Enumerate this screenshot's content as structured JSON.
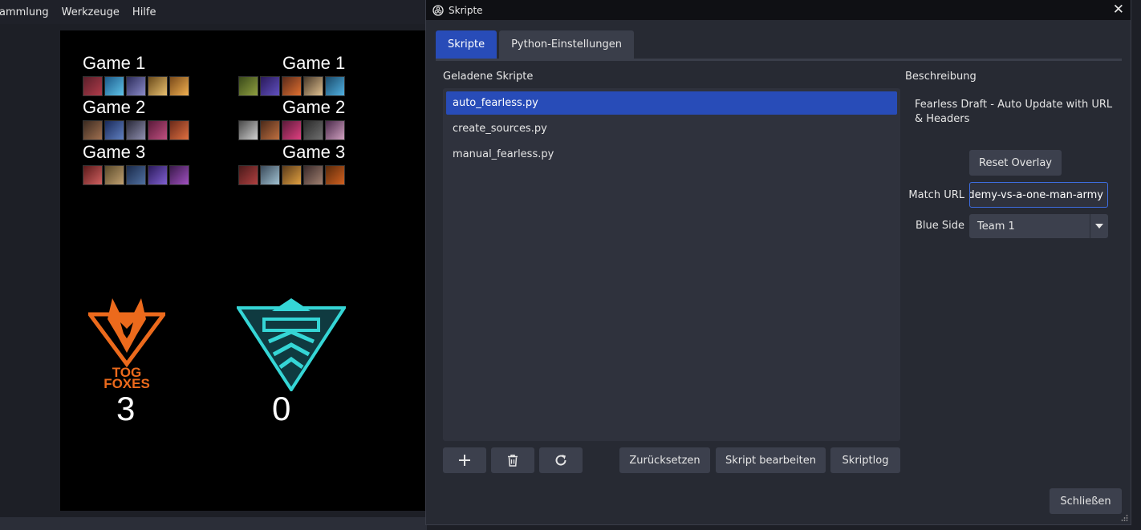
{
  "main_window": {
    "menu": [
      "ammlung",
      "Werkzeuge",
      "Hilfe"
    ]
  },
  "overlay": {
    "left_games": [
      "Game 1",
      "Game 2",
      "Game 3"
    ],
    "right_games": [
      "Game 1",
      "Game 2",
      "Game 3"
    ],
    "left_team_name": "TOG FOXES",
    "left_score": "3",
    "right_score": "0",
    "colors": {
      "fox_orange": "#ec6a1c",
      "right_team_teal": "#35d6d6"
    }
  },
  "dialog": {
    "title": "Skripte",
    "close_icon": "close-icon",
    "tabs": [
      {
        "label": "Skripte",
        "active": true
      },
      {
        "label": "Python-Einstellungen",
        "active": false
      }
    ],
    "loaded_scripts_label": "Geladene Skripte",
    "scripts": [
      {
        "name": "auto_fearless.py",
        "selected": true
      },
      {
        "name": "create_sources.py",
        "selected": false
      },
      {
        "name": "manual_fearless.py",
        "selected": false
      }
    ],
    "icon_buttons": [
      "add-icon",
      "trash-icon",
      "reload-icon"
    ],
    "buttons": {
      "reset": "Zurücksetzen",
      "edit": "Skript bearbeiten",
      "log": "Skriptlog",
      "close": "Schließen"
    },
    "description_label": "Beschreibung",
    "description": "Fearless Draft - Auto Update with URL & Headers",
    "properties": {
      "reset_overlay_label": "Reset Overlay",
      "match_url_label": "Match URL",
      "match_url_value": "ademy-vs-a-one-man-army",
      "blue_side_label": "Blue Side",
      "blue_side_value": "Team 1"
    },
    "colors": {
      "accent": "#284cb8",
      "input_focus": "#3d6de0"
    }
  }
}
